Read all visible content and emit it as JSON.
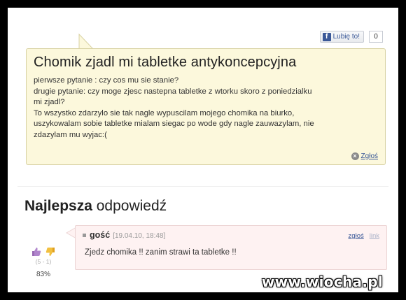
{
  "like": {
    "icon": "facebook-icon",
    "label": "Lubię to!",
    "count": "0"
  },
  "question": {
    "title": "Chomik zjadl mi tabletke antykoncepcyjna",
    "lines": [
      "pierwsze pytanie : czy cos mu sie stanie?",
      "drugie pytanie: czy moge zjesc nastepna tabletke z wtorku skoro z poniedzialku",
      "mi zjadl?",
      "To wszystko zdarzylo sie tak nagle wypuscilam mojego chomika na biurko,",
      "uszykowalam sobie tabletke mialam siegac po wode gdy nagle zauwazylam, nie",
      "zdazylam mu wyjac:("
    ],
    "report_label": "Zgłoś"
  },
  "best_answer": {
    "heading_bold": "Najlepsza",
    "heading_rest": " odpowiedź"
  },
  "answer": {
    "author": "gość",
    "date": "[19.04.10, 18:48]",
    "report_label": "zgłoś",
    "link_label": "link",
    "text": "Zjedz chomika !! zanim strawi ta tabletke !!",
    "vote_score": "(5 - 1)",
    "percent": "83%"
  },
  "watermark": "www.wiocha.pl",
  "colors": {
    "question_bg": "#fcf8dc",
    "answer_bg": "#fef2f2",
    "link": "#3b5998"
  }
}
